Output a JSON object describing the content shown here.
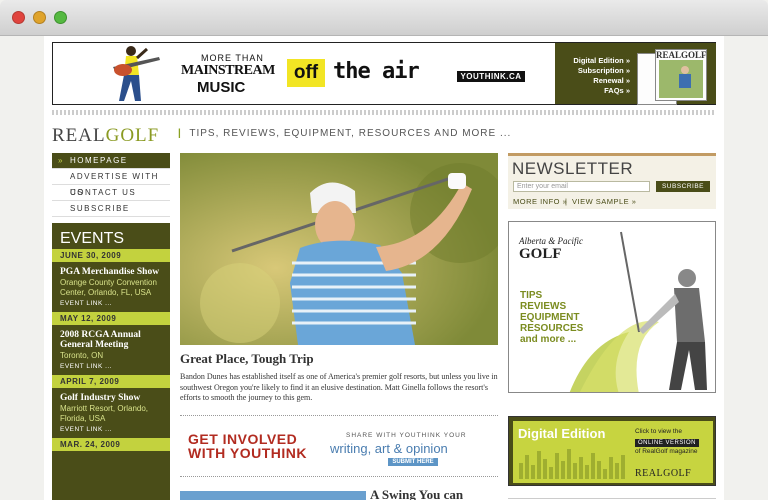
{
  "banner": {
    "line1": "MORE THAN",
    "line2": "MAINSTREAM",
    "line3": "MUSIC",
    "off_label": "off",
    "the_air_label": "the air",
    "site": "YOUTHINK.CA",
    "links": [
      "Digital Edition",
      "Subscription",
      "Renewal",
      "FAQs"
    ],
    "mag_label": "REALGOLF"
  },
  "header": {
    "logo_real": "REAL",
    "logo_golf": "GOLF",
    "tagline": "TIPS, REVIEWS, EQUIPMENT, RESOURCES AND MORE ..."
  },
  "nav": {
    "items": [
      "HOMEPAGE",
      "ADVERTISE WITH US",
      "CONTACT US",
      "SUBSCRIBE"
    ]
  },
  "events": {
    "heading": "EVENTS",
    "items": [
      {
        "date": "JUNE 30, 2009",
        "title": "PGA Merchandise Show",
        "location": "Orange County Convention Center, Orlando, FL, USA",
        "link": "EVENT LINK ..."
      },
      {
        "date": "MAY 12, 2009",
        "title": "2008 RCGA Annual General Meeting",
        "location": "Toronto, ON",
        "link": "EVENT LINK ..."
      },
      {
        "date": "APRIL 7, 2009",
        "title": "Golf Industry Show",
        "location": "Marriott Resort, Orlando, Florida, USA",
        "link": "EVENT LINK ..."
      },
      {
        "date": "MAR. 24, 2009",
        "title": "",
        "location": "",
        "link": ""
      }
    ]
  },
  "main": {
    "story_title": "Great Place, Tough Trip",
    "story_body": "Bandon Dunes has established itself as one of America's premier golf resorts, but unless you live in southwest Oregon you're likely to find it an elusive destination. Matt Ginella follows the resort's efforts to smooth the journey to this gem.",
    "promo": {
      "line1": "GET INVOLVED",
      "line2": "WITH YOUTHINK",
      "small": "SHARE WITH YOUTHINK YOUR",
      "big": "writing, art & opinion",
      "button": "SUBMIT HERE"
    },
    "second_title": "A Swing You can"
  },
  "newsletter": {
    "heading": "NEWSLETTER",
    "placeholder": "Enter your email",
    "button": "SUBSCRIBE",
    "more_info": "MORE INFO »",
    "separator": "|",
    "view_sample": "VIEW SAMPLE »"
  },
  "ad_golf": {
    "brand": "Alberta & Pacific",
    "title": "GOLF",
    "list": [
      "TIPS",
      "REVIEWS",
      "EQUIPMENT",
      "RESOURCES",
      "and more ..."
    ]
  },
  "digital": {
    "title": "Digital Edition",
    "click": "Click to view the",
    "button": "ONLINE VERSION",
    "rest": "of RealGolf magazine",
    "logo": "REALGOLF"
  },
  "colors": {
    "olive": "#4a4d18",
    "lime": "#c3d23e",
    "accent_red": "#b22b20"
  }
}
